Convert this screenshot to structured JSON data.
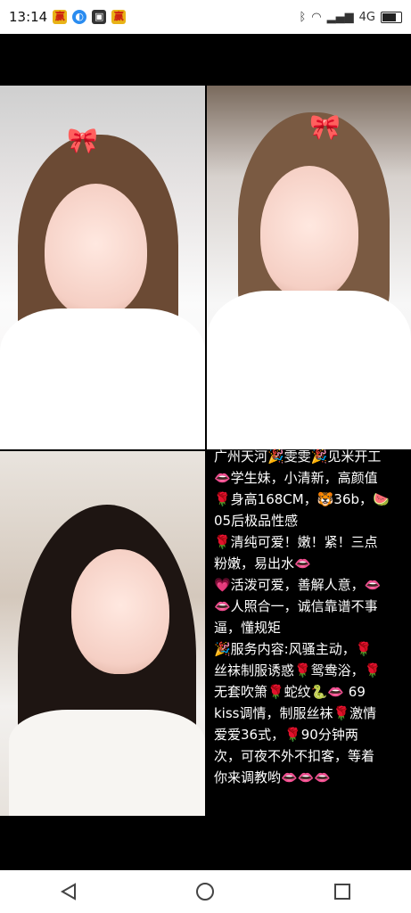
{
  "status_bar": {
    "time": "13:14",
    "right_text": "4G"
  },
  "photos": {
    "photo1": "woman-with-cat-filter-1",
    "photo2": "woman-with-cat-filter-2",
    "photo3": "woman-long-hair-selfie"
  },
  "caption": {
    "lines": [
      "广州天河🎉雯雯🎉见米开工",
      "👄学生妹，小清新，高颜值",
      "🌹身高168CM，🐯36b，🍉",
      "05后极品性感",
      "🌹清纯可爱！嫩！紧！三点",
      "粉嫩，易出水👄",
      "💗活泼可爱，善解人意，👄",
      "👄人照合一，诚信靠谱不事",
      "逼，懂规矩",
      "🎉服务内容:风骚主动，🌹",
      "丝袜制服诱惑🌹鸳鸯浴，🌹",
      "无套吹箫🌹蛇纹🐍👄 69",
      "kiss调情，制服丝袜🌹激情",
      "爱爱36式，🌹90分钟两",
      "次，可夜不外不扣客，等着",
      "你来调教哟👄👄👄"
    ]
  },
  "nav": {
    "back": "back-icon",
    "home": "home-icon",
    "recent": "recent-apps-icon"
  }
}
